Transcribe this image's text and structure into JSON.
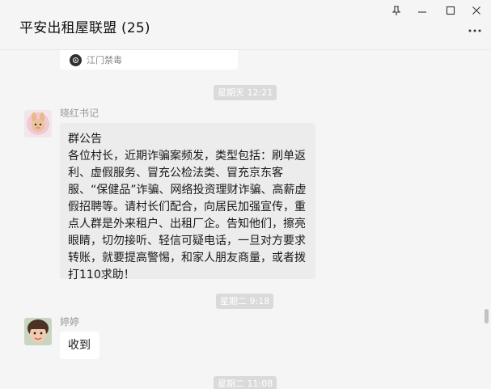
{
  "window": {
    "title": "平安出租屋联盟 (25)"
  },
  "card": {
    "source": "江门禁毒"
  },
  "messages": [
    {
      "type": "time",
      "text": "星期天 12:21"
    },
    {
      "type": "announcement",
      "sender": "晓红书记",
      "title": "群公告",
      "body": "各位村长，近期诈骗案频发，类型包括：刷单返利、虚假服务、冒充公检法类、冒充京东客服、“保健品”诈骗、网络投资理财诈骗、高薪虚假招聘等。请村长们配合，向居民加强宣传，重点人群是外来租户、出租厂企。告知他们，擦亮眼睛，切勿接听、轻信可疑电话，一旦对方要求转账，就要提高警惕，和家人朋友商量，或者拨打110求助！"
    },
    {
      "type": "time",
      "text": "星期二 9:18"
    },
    {
      "type": "text",
      "sender": "婷婷",
      "text": "收到"
    },
    {
      "type": "time",
      "text": "星期二 11:08"
    }
  ],
  "colors": {
    "background": "#f5f5f5",
    "bubble": "#ffffff",
    "announcement_bubble": "#ececec",
    "time_badge": "#dadada"
  },
  "icons": [
    "pin-icon",
    "minimize-icon",
    "maximize-icon",
    "close-icon",
    "more-icon"
  ]
}
